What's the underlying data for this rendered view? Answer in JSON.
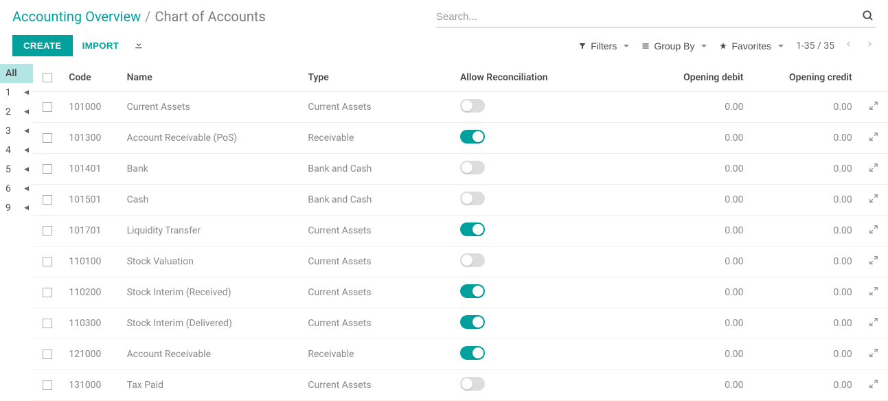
{
  "breadcrumb": {
    "parent": "Accounting Overview",
    "separator": "/",
    "current": "Chart of Accounts"
  },
  "search": {
    "placeholder": "Search..."
  },
  "toolbar": {
    "create": "CREATE",
    "import": "IMPORT",
    "filters": "Filters",
    "group_by": "Group By",
    "favorites": "Favorites",
    "pager": "1-35 / 35"
  },
  "side_index": {
    "all": "All",
    "items": [
      "1",
      "2",
      "3",
      "4",
      "5",
      "6",
      "9"
    ]
  },
  "columns": {
    "code": "Code",
    "name": "Name",
    "type": "Type",
    "reconcile": "Allow Reconciliation",
    "debit": "Opening debit",
    "credit": "Opening credit"
  },
  "rows": [
    {
      "code": "101000",
      "name": "Current Assets",
      "type": "Current Assets",
      "reconcile": false,
      "debit": "0.00",
      "credit": "0.00"
    },
    {
      "code": "101300",
      "name": "Account Receivable (PoS)",
      "type": "Receivable",
      "reconcile": true,
      "debit": "0.00",
      "credit": "0.00"
    },
    {
      "code": "101401",
      "name": "Bank",
      "type": "Bank and Cash",
      "reconcile": false,
      "debit": "0.00",
      "credit": "0.00"
    },
    {
      "code": "101501",
      "name": "Cash",
      "type": "Bank and Cash",
      "reconcile": false,
      "debit": "0.00",
      "credit": "0.00"
    },
    {
      "code": "101701",
      "name": "Liquidity Transfer",
      "type": "Current Assets",
      "reconcile": true,
      "debit": "0.00",
      "credit": "0.00"
    },
    {
      "code": "110100",
      "name": "Stock Valuation",
      "type": "Current Assets",
      "reconcile": false,
      "debit": "0.00",
      "credit": "0.00"
    },
    {
      "code": "110200",
      "name": "Stock Interim (Received)",
      "type": "Current Assets",
      "reconcile": true,
      "debit": "0.00",
      "credit": "0.00"
    },
    {
      "code": "110300",
      "name": "Stock Interim (Delivered)",
      "type": "Current Assets",
      "reconcile": true,
      "debit": "0.00",
      "credit": "0.00"
    },
    {
      "code": "121000",
      "name": "Account Receivable",
      "type": "Receivable",
      "reconcile": true,
      "debit": "0.00",
      "credit": "0.00"
    },
    {
      "code": "131000",
      "name": "Tax Paid",
      "type": "Current Assets",
      "reconcile": false,
      "debit": "0.00",
      "credit": "0.00"
    }
  ]
}
